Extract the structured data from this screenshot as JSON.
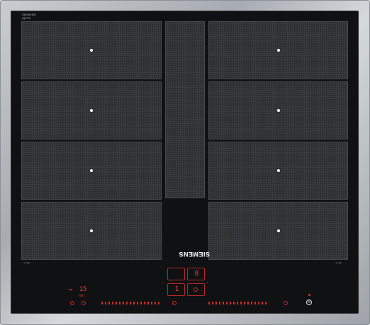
{
  "product": {
    "brand": "SIEMENS",
    "series_badge": [
      "SIEMENS",
      "iQ700"
    ],
    "model_label": "",
    "left_corner_label": "fN 4...",
    "right_corner_label": "fN 4..."
  },
  "display": {
    "top_digit": "8",
    "mid_digit": "1",
    "timer_readout": "15",
    "timer_unit": "min"
  },
  "controls": {
    "power_symbol": "①",
    "left_slider_label": "",
    "right_slider_label": ""
  },
  "colors": {
    "glass": "#101112",
    "zone_fill": "#2b2c2e",
    "indicator_red": "#e0332e",
    "frame_steel": "#b2b6bb"
  },
  "icons": [
    "zone-center-dot",
    "timer-icon",
    "lock-icon",
    "power-icon",
    "slider-marks"
  ]
}
